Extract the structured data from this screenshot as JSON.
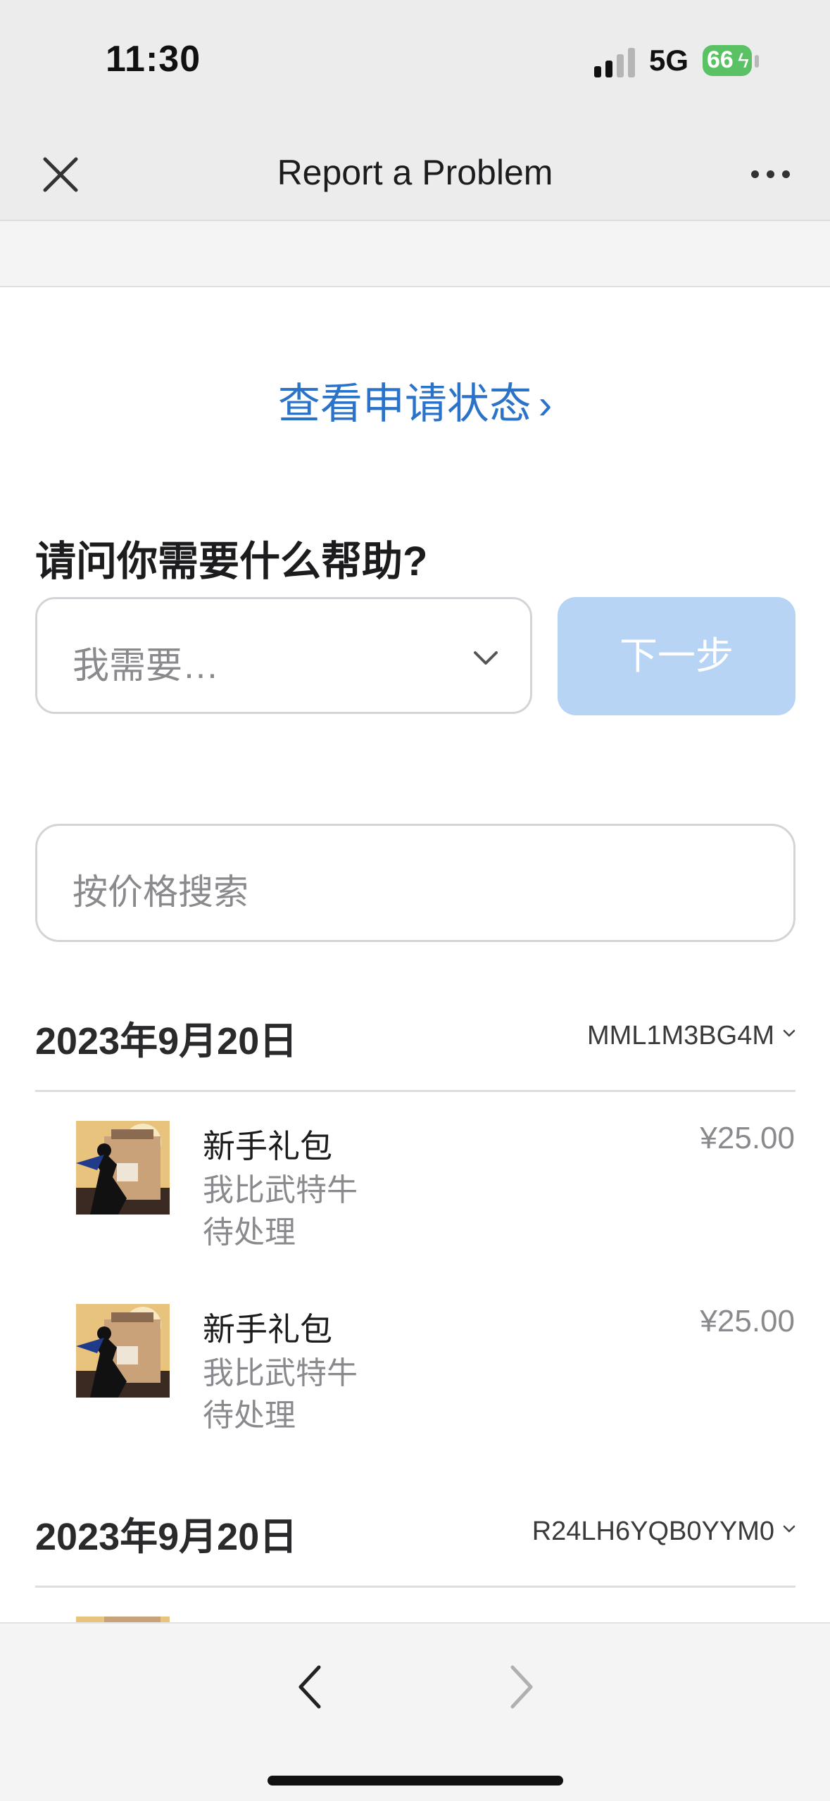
{
  "status_bar": {
    "time": "11:30",
    "network": "5G",
    "battery": "66"
  },
  "nav": {
    "title": "Report a Problem",
    "close_icon": "close-icon",
    "more_icon": "more-horizontal-icon"
  },
  "status_link": {
    "label": "查看申请状态",
    "chevron": "›"
  },
  "help": {
    "title": "请问你需要什么帮助?",
    "select_placeholder": "我需要…",
    "next_label": "下一步",
    "next_color": "#b7d4f5"
  },
  "search": {
    "placeholder": "按价格搜索"
  },
  "orders": [
    {
      "date": "2023年9月20日",
      "order_id": "MML1M3BG4M",
      "items": [
        {
          "name": "新手礼包",
          "seller": "我比武特牛",
          "status": "待处理",
          "price": "¥25.00"
        },
        {
          "name": "新手礼包",
          "seller": "我比武特牛",
          "status": "待处理",
          "price": "¥25.00"
        }
      ]
    },
    {
      "date": "2023年9月20日",
      "order_id": "R24LH6YQB0YYM0",
      "items": []
    }
  ],
  "colors": {
    "link_blue": "#2b73c9",
    "battery_green": "#5ac164"
  }
}
